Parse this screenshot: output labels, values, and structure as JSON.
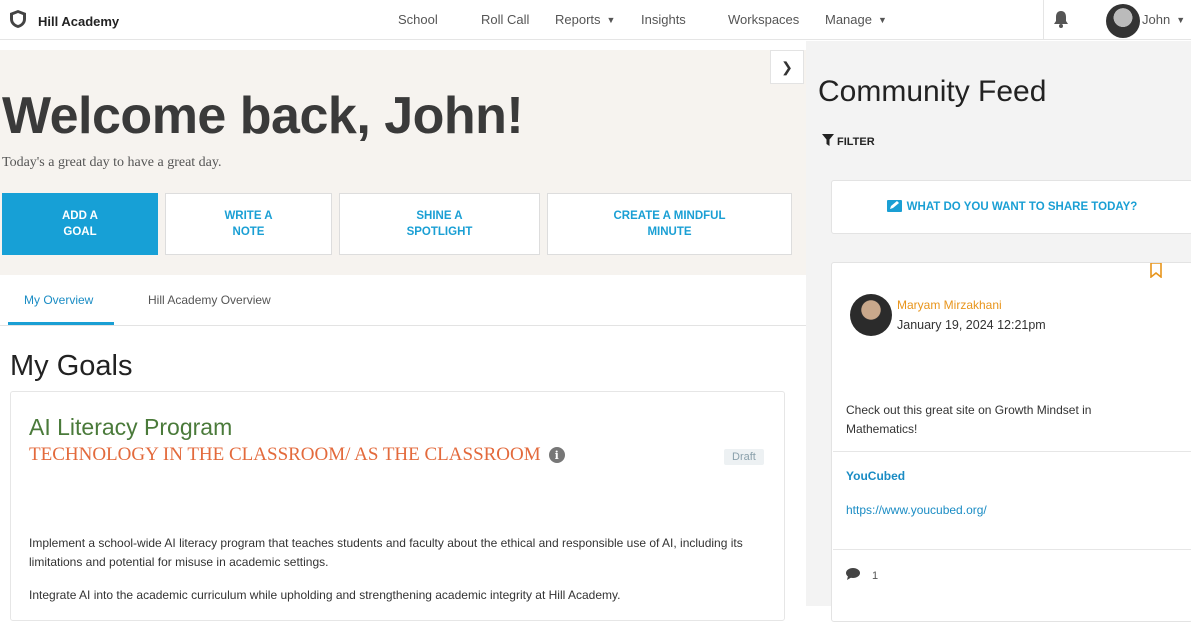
{
  "brand": {
    "name": "Hill Academy"
  },
  "nav": {
    "items": [
      {
        "label": "School"
      },
      {
        "label": "Roll Call"
      },
      {
        "label": "Reports"
      },
      {
        "label": "Insights"
      },
      {
        "label": "Workspaces"
      },
      {
        "label": "Manage"
      }
    ],
    "user": "John"
  },
  "hero": {
    "title": "Welcome back, John!",
    "tagline": "Today's a great day to have a great day.",
    "actions": [
      {
        "label": "ADD A\nGOAL"
      },
      {
        "label": "WRITE A\nNOTE"
      },
      {
        "label": "SHINE A\nSPOTLIGHT"
      },
      {
        "label": "CREATE A MINDFUL\nMINUTE"
      }
    ]
  },
  "tabs": [
    {
      "label": "My Overview",
      "active": true
    },
    {
      "label": "Hill Academy Overview",
      "active": false
    }
  ],
  "goals": {
    "title": "My Goals",
    "items": [
      {
        "name": "AI Literacy Program",
        "category": "TECHNOLOGY IN THE CLASSROOM/ AS THE CLASSROOM",
        "status": "Draft",
        "description": "Implement a school-wide AI literacy program that teaches students and faculty about the ethical and responsible use of AI, including its limitations and potential for misuse in academic settings.",
        "description2": "Integrate AI into the academic curriculum while upholding and strengthening academic integrity at Hill Academy."
      }
    ]
  },
  "feed": {
    "title": "Community Feed",
    "filter_label": "FILTER",
    "share_prompt": "WHAT DO YOU WANT TO SHARE TODAY?",
    "posts": [
      {
        "author": "Maryam Mirzakhani",
        "date": "January 19, 2024 12:21pm",
        "text": "Check out this great site on Growth Mindset in Mathematics!",
        "link_title": "YouCubed",
        "link_url": "https://www.youcubed.org/",
        "comment_count": "1"
      }
    ]
  },
  "colors": {
    "accent": "#17a0d6",
    "goal_name": "#4a7a3a",
    "goal_category": "#e36a3c",
    "author": "#e8951c",
    "hero_bg": "#f6f3ef"
  }
}
